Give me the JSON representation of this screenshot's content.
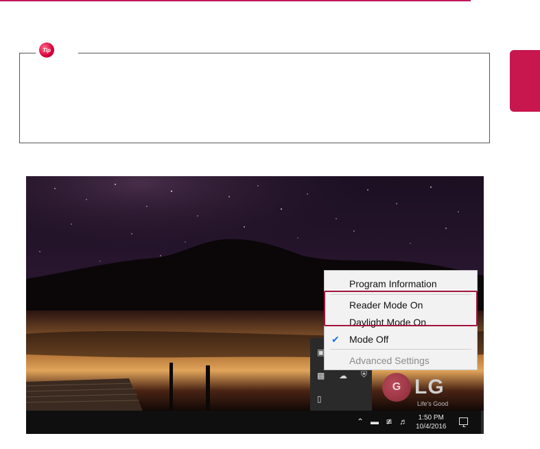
{
  "tip": {
    "badge_label": "Tip"
  },
  "logo": {
    "mark": "G",
    "brand": "LG",
    "tagline": "Life's Good"
  },
  "context_menu": {
    "items": [
      {
        "label": "Program Information",
        "checked": false,
        "disabled": false
      },
      {
        "label": "Reader Mode On",
        "checked": false,
        "disabled": false
      },
      {
        "label": "Daylight Mode On",
        "checked": false,
        "disabled": false
      },
      {
        "label": "Mode Off",
        "checked": true,
        "disabled": false
      },
      {
        "label": "Advanced Settings",
        "checked": false,
        "disabled": true
      }
    ],
    "highlighted_items": [
      "Reader Mode On",
      "Daylight Mode On"
    ]
  },
  "taskbar": {
    "time": "1:50 PM",
    "date": "10/4/2016",
    "icons": [
      "chevron-up-icon",
      "battery-icon",
      "wifi-icon",
      "volume-icon",
      "notification-icon"
    ]
  },
  "tray_overflow": {
    "icons": [
      "chat-icon",
      "reader-r-icon",
      "cloud-icon",
      "shield-icon",
      "usb-icon"
    ]
  },
  "colors": {
    "accent": "#c8174f",
    "highlight": "#a3143d",
    "check": "#1a73e8"
  }
}
